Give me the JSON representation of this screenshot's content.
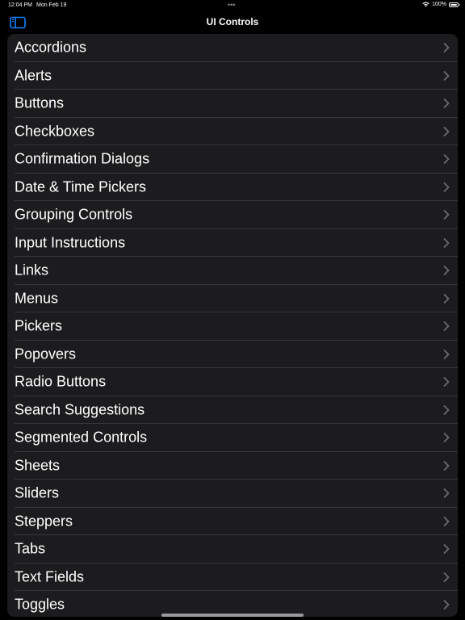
{
  "status_bar": {
    "time": "12:04 PM",
    "date": "Mon Feb 19",
    "dots": "•••",
    "battery": "100%"
  },
  "nav": {
    "title": "UI Controls"
  },
  "colors": {
    "accent": "#0a84ff",
    "background": "#000000",
    "list_background": "#1c1c1e",
    "separator": "#38383a",
    "chevron": "#6b6b70"
  },
  "list": {
    "items": [
      {
        "label": "Accordions"
      },
      {
        "label": "Alerts"
      },
      {
        "label": "Buttons"
      },
      {
        "label": "Checkboxes"
      },
      {
        "label": "Confirmation Dialogs"
      },
      {
        "label": "Date & Time Pickers"
      },
      {
        "label": "Grouping Controls"
      },
      {
        "label": "Input Instructions"
      },
      {
        "label": "Links"
      },
      {
        "label": "Menus"
      },
      {
        "label": "Pickers"
      },
      {
        "label": "Popovers"
      },
      {
        "label": "Radio Buttons"
      },
      {
        "label": "Search Suggestions"
      },
      {
        "label": "Segmented Controls"
      },
      {
        "label": "Sheets"
      },
      {
        "label": "Sliders"
      },
      {
        "label": "Steppers"
      },
      {
        "label": "Tabs"
      },
      {
        "label": "Text Fields"
      },
      {
        "label": "Toggles"
      }
    ]
  }
}
